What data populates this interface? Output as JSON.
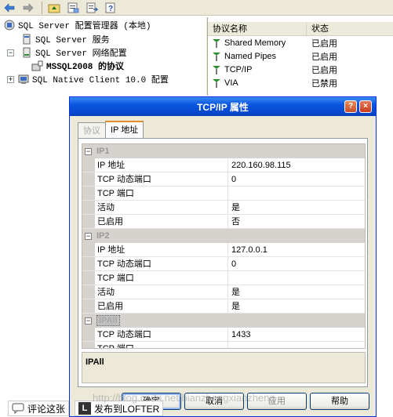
{
  "toolbar": {
    "buttons": [
      "back-icon",
      "forward-icon",
      "up-folder-icon",
      "properties-icon",
      "export-list-icon",
      "help-icon"
    ]
  },
  "tree": {
    "root": "SQL Server 配置管理器 (本地)",
    "items": [
      "SQL Server 服务",
      "SQL Server 网络配置",
      "MSSQL2008 的协议",
      "SQL Native Client 10.0 配置"
    ]
  },
  "list": {
    "headers": [
      "协议名称",
      "状态"
    ],
    "rows": [
      {
        "name": "Shared Memory",
        "status": "已启用"
      },
      {
        "name": "Named Pipes",
        "status": "已启用"
      },
      {
        "name": "TCP/IP",
        "status": "已启用"
      },
      {
        "name": "VIA",
        "status": "已禁用"
      }
    ]
  },
  "dialog": {
    "title": "TCP/IP 属性",
    "help_btn": "?",
    "close_btn": "×",
    "tabs": [
      "协议",
      "IP 地址"
    ],
    "groups": [
      {
        "name": "IP1",
        "rows": [
          {
            "k": "IP 地址",
            "v": "220.160.98.115"
          },
          {
            "k": "TCP 动态端口",
            "v": "0"
          },
          {
            "k": "TCP 端口",
            "v": ""
          },
          {
            "k": "活动",
            "v": "是"
          },
          {
            "k": "已启用",
            "v": "否"
          }
        ]
      },
      {
        "name": "IP2",
        "rows": [
          {
            "k": "IP 地址",
            "v": "127.0.0.1"
          },
          {
            "k": "TCP 动态端口",
            "v": "0"
          },
          {
            "k": "TCP 端口",
            "v": ""
          },
          {
            "k": "活动",
            "v": "是"
          },
          {
            "k": "已启用",
            "v": "是"
          }
        ]
      },
      {
        "name": "IPAll",
        "rows": [
          {
            "k": "TCP 动态端口",
            "v": "1433"
          },
          {
            "k": "TCP 端口",
            "v": ""
          }
        ]
      }
    ],
    "description": "IPAll",
    "buttons": {
      "ok": "确定",
      "cancel": "取消",
      "apply": "应用",
      "help": "帮助"
    }
  },
  "bottom": {
    "comment": "评论这张",
    "lofter": "发布到LOFTER"
  },
  "watermark": "http://blog.csdn.net/bianzhengxianzheng"
}
